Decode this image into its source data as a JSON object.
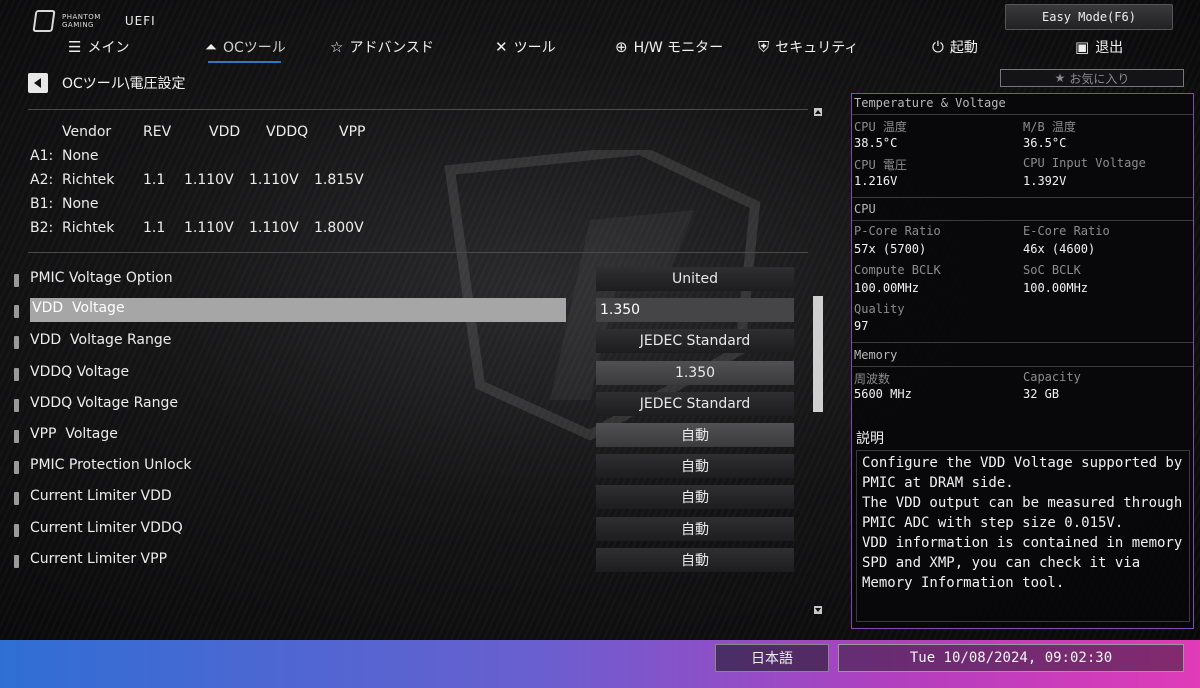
{
  "brand": {
    "logo_line1": "PHANTOM",
    "logo_line2": "GAMING",
    "product": "UEFI"
  },
  "easy_mode_label": "Easy Mode(F6)",
  "nav": [
    {
      "label": "メイン",
      "icon": "list-icon"
    },
    {
      "label": "OCツール",
      "icon": "rocket-icon",
      "active": true
    },
    {
      "label": "アドバンスド",
      "icon": "star-icon"
    },
    {
      "label": "ツール",
      "icon": "tools-icon"
    },
    {
      "label": "H/W モニター",
      "icon": "target-icon"
    },
    {
      "label": "セキュリティ",
      "icon": "shield-icon"
    },
    {
      "label": "起動",
      "icon": "power-icon"
    },
    {
      "label": "退出",
      "icon": "exit-icon"
    }
  ],
  "breadcrumb": "OCツール\\電圧設定",
  "memory_table": {
    "headers": [
      "Vendor",
      "REV",
      "VDD",
      "VDDQ",
      "VPP"
    ],
    "rows": [
      {
        "slot": "A1:",
        "vendor": "None",
        "rev": "",
        "vdd": "",
        "vddq": "",
        "vpp": ""
      },
      {
        "slot": "A2:",
        "vendor": "Richtek",
        "rev": "1.1",
        "vdd": "1.110V",
        "vddq": "1.110V",
        "vpp": "1.815V"
      },
      {
        "slot": "B1:",
        "vendor": "None",
        "rev": "",
        "vdd": "",
        "vddq": "",
        "vpp": ""
      },
      {
        "slot": "B2:",
        "vendor": "Richtek",
        "rev": "1.1",
        "vdd": "1.110V",
        "vddq": "1.110V",
        "vpp": "1.800V"
      }
    ]
  },
  "settings": [
    {
      "label": "PMIC Voltage Option",
      "value": "United"
    },
    {
      "label": "VDD  Voltage",
      "value": "1.350",
      "selected": true
    },
    {
      "label": "VDD  Voltage Range",
      "value": "JEDEC Standard"
    },
    {
      "label": "VDDQ Voltage",
      "value": "1.350"
    },
    {
      "label": "VDDQ Voltage Range",
      "value": "JEDEC Standard"
    },
    {
      "label": "VPP  Voltage",
      "value": "自動"
    },
    {
      "label": "PMIC Protection Unlock",
      "value": "自動"
    },
    {
      "label": "Current Limiter VDD",
      "value": "自動"
    },
    {
      "label": "Current Limiter VDDQ",
      "value": "自動"
    },
    {
      "label": "Current Limiter VPP",
      "value": "自動"
    }
  ],
  "favorites_label": "お気に入り",
  "panel": {
    "temp_title": "Temperature & Voltage",
    "cpu_temp_label": "CPU 温度",
    "cpu_temp": "38.5°C",
    "mb_temp_label": "M/B 温度",
    "mb_temp": "36.5°C",
    "cpu_volt_label": "CPU 電圧",
    "cpu_volt": "1.216V",
    "cpu_input_label": "CPU Input Voltage",
    "cpu_input": "1.392V",
    "cpu_title": "CPU",
    "pcore_label": "P-Core Ratio",
    "pcore": "57x (5700)",
    "ecore_label": "E-Core Ratio",
    "ecore": "46x (4600)",
    "cbclk_label": "Compute BCLK",
    "cbclk": "100.00MHz",
    "socbclk_label": "SoC BCLK",
    "socbclk": "100.00MHz",
    "quality_label": "Quality",
    "quality": "97",
    "mem_title": "Memory",
    "freq_label": "周波数",
    "freq": "5600 MHz",
    "cap_label": "Capacity",
    "cap": "32 GB",
    "desc_title": "説明",
    "description": "Configure the VDD Voltage supported by\nPMIC at DRAM side.\nThe VDD output can be measured through\nPMIC ADC with step size 0.015V.\nVDD information is contained in memory\nSPD and XMP, you can check it via\nMemory Information tool."
  },
  "footer": {
    "language": "日本語",
    "datetime": "Tue 10/08/2024, 09:02:30"
  }
}
